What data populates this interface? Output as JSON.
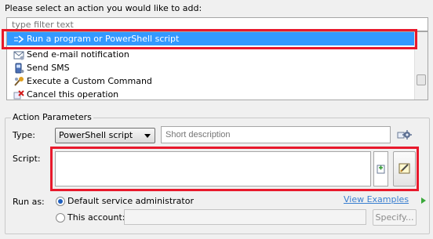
{
  "prompt": "Please select an action you would like to add:",
  "filter": {
    "placeholder": "type filter text"
  },
  "actions": [
    {
      "label": "Run a program or PowerShell script",
      "icon": "powershell-icon",
      "selected": true
    },
    {
      "label": "Send e-mail notification",
      "icon": "email-icon",
      "selected": false
    },
    {
      "label": "Send SMS",
      "icon": "sms-phone-icon",
      "selected": false
    },
    {
      "label": "Execute a Custom Command",
      "icon": "custom-command-icon",
      "selected": false
    },
    {
      "label": "Cancel this operation",
      "icon": "cancel-x-icon",
      "selected": false
    }
  ],
  "params": {
    "legend": "Action Parameters",
    "type_label": "Type:",
    "type_value": "PowerShell script",
    "description_placeholder": "Short description",
    "script_label": "Script:",
    "run_as_label": "Run as:",
    "run_as_default": "Default service administrator",
    "run_as_account": "This account:",
    "view_examples": "View Examples",
    "specify_button": "Specify..."
  },
  "colors": {
    "selection": "#3399ff",
    "highlight": "#e8192c",
    "link": "#3a7fd0"
  }
}
